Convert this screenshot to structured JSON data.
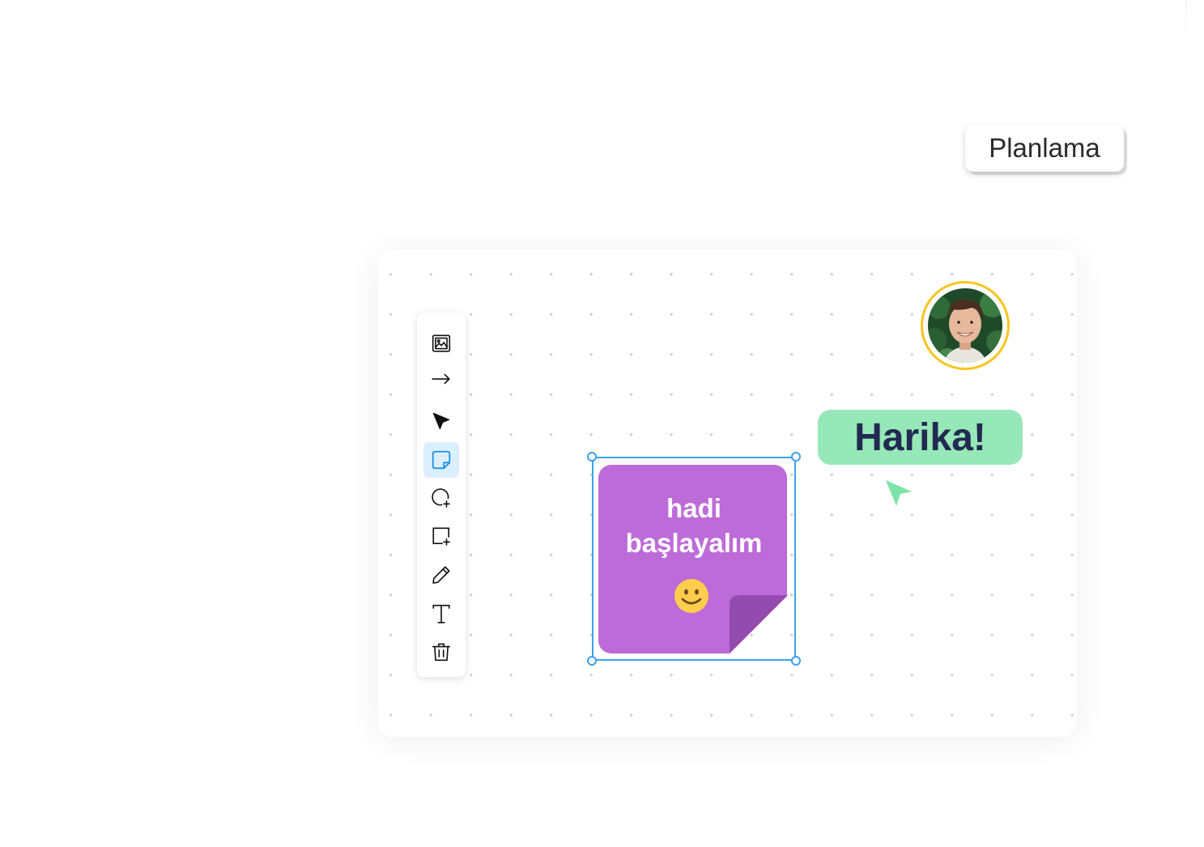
{
  "tag": {
    "label": "Planlama"
  },
  "toolbar": {
    "tools": [
      {
        "name": "image-tool",
        "icon": "image-icon",
        "active": false
      },
      {
        "name": "arrow-tool",
        "icon": "arrow-right-icon",
        "active": false
      },
      {
        "name": "select-tool",
        "icon": "cursor-icon",
        "active": false
      },
      {
        "name": "sticky-note-tool",
        "icon": "sticky-note-icon",
        "active": true
      },
      {
        "name": "circle-tool",
        "icon": "circle-plus-icon",
        "active": false
      },
      {
        "name": "rectangle-tool",
        "icon": "square-plus-icon",
        "active": false
      },
      {
        "name": "pen-tool",
        "icon": "pencil-icon",
        "active": false
      },
      {
        "name": "text-tool",
        "icon": "text-icon",
        "active": false
      },
      {
        "name": "delete-tool",
        "icon": "trash-icon",
        "active": false
      }
    ]
  },
  "bubble": {
    "text": "Harika!"
  },
  "sticky_note": {
    "line1": "hadi",
    "line2": "başlayalım",
    "emoji": "smiley-icon"
  },
  "colors": {
    "selection": "#3da1ec",
    "note": "#bd6bd9",
    "note_fold": "#944bb0",
    "bubble": "#97e8b8",
    "bubble_text": "#232a52",
    "avatar_ring": "#f8c51c",
    "pointer": "#7ee3a8",
    "active_tool": "#dcefff"
  }
}
